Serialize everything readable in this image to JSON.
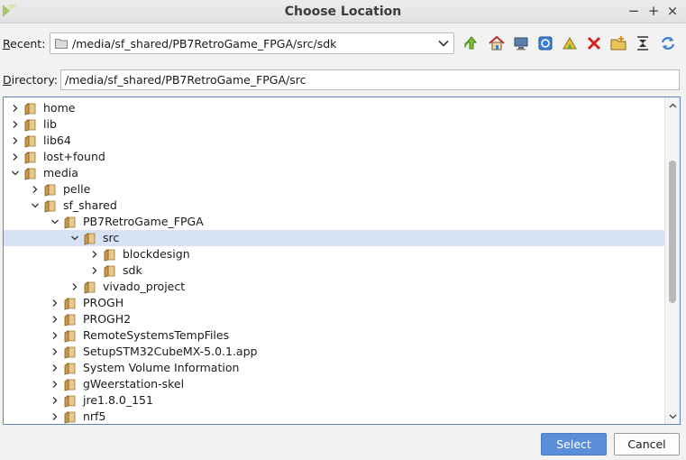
{
  "window": {
    "title": "Choose Location",
    "controls": {
      "minimize": "−",
      "maximize": "+",
      "close": "×"
    }
  },
  "recent": {
    "label_prefix": "",
    "label_mnemonic": "R",
    "label_rest": "ecent:",
    "value": "/media/sf_shared/PB7RetroGame_FPGA/src/sdk"
  },
  "toolbar": {
    "icons": [
      "up-folder-icon",
      "home-icon",
      "desktop-icon",
      "project-icon",
      "bookmark-icon",
      "delete-icon",
      "new-folder-icon",
      "collapse-all-icon",
      "refresh-icon"
    ]
  },
  "directory": {
    "label_mnemonic": "D",
    "label_rest": "irectory:",
    "value": "/media/sf_shared/PB7RetroGame_FPGA/src"
  },
  "tree": {
    "rows": [
      {
        "label": "home",
        "expanded": false
      },
      {
        "label": "lib",
        "expanded": false
      },
      {
        "label": "lib64",
        "expanded": false
      },
      {
        "label": "lost+found",
        "expanded": false
      },
      {
        "label": "media",
        "expanded": true
      },
      {
        "label": "pelle",
        "expanded": false
      },
      {
        "label": "sf_shared",
        "expanded": true
      },
      {
        "label": "PB7RetroGame_FPGA",
        "expanded": true
      },
      {
        "label": "src",
        "expanded": true,
        "selected": true
      },
      {
        "label": "blockdesign",
        "expanded": false
      },
      {
        "label": "sdk",
        "expanded": false
      },
      {
        "label": "vivado_project",
        "expanded": false
      },
      {
        "label": "PROGH",
        "expanded": false
      },
      {
        "label": "PROGH2",
        "expanded": false
      },
      {
        "label": "RemoteSystemsTempFiles",
        "expanded": false
      },
      {
        "label": "SetupSTM32CubeMX-5.0.1.app",
        "expanded": false
      },
      {
        "label": "System Volume Information",
        "expanded": false
      },
      {
        "label": "gWeerstation-skel",
        "expanded": false
      },
      {
        "label": "jre1.8.0_151",
        "expanded": false
      },
      {
        "label": "nrf5",
        "expanded": false
      }
    ]
  },
  "buttons": {
    "select": "Select",
    "cancel": "Cancel"
  },
  "colors": {
    "selection": "#d7e3f5",
    "accent": "#5b8ed8",
    "folder": "#c99a48"
  }
}
